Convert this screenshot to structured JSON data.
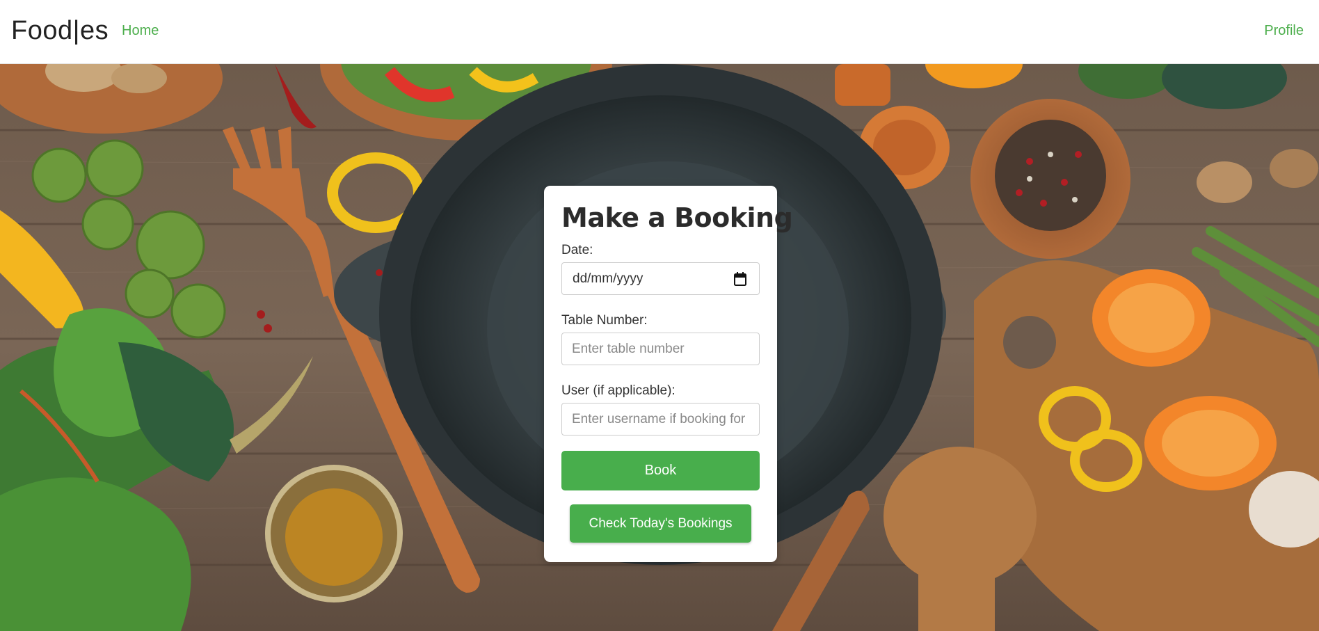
{
  "navbar": {
    "brand": "Food|es",
    "home_label": "Home",
    "profile_label": "Profile"
  },
  "booking": {
    "title": "Make a Booking",
    "date_label": "Date:",
    "date_value": "dd/mm/yyyy",
    "table_label": "Table Number:",
    "table_placeholder": "Enter table number",
    "user_label": "User (if applicable):",
    "user_placeholder": "Enter username if booking for others",
    "book_button": "Book",
    "check_button": "Check Today's Bookings"
  },
  "colors": {
    "accent": "#48ae4c",
    "link": "#4cae4c",
    "card_bg": "#ffffff"
  },
  "icons": {
    "calendar": "calendar-icon"
  }
}
